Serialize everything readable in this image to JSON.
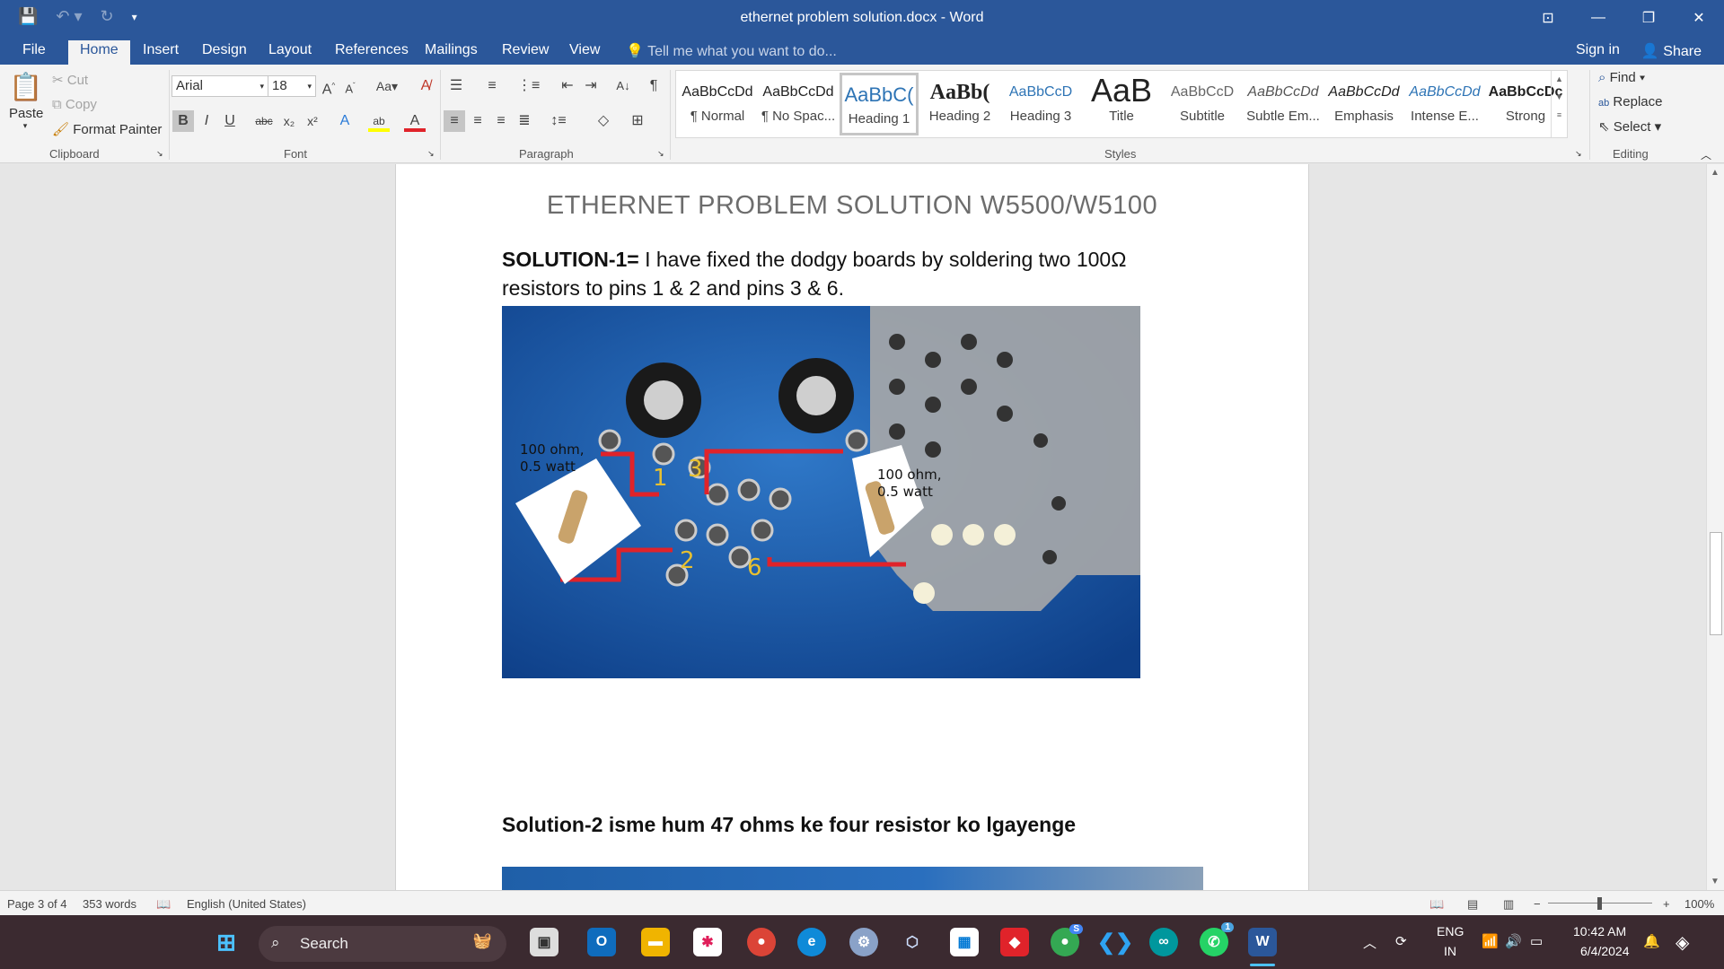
{
  "window": {
    "title": "ethernet problem solution.docx - Word",
    "controls": [
      "ribbon-display",
      "minimize",
      "restore",
      "close"
    ]
  },
  "tabs": {
    "items": [
      "File",
      "Home",
      "Insert",
      "Design",
      "Layout",
      "References",
      "Mailings",
      "Review",
      "View"
    ],
    "active": "Home",
    "tell_me": "Tell me what you want to do...",
    "sign_in": "Sign in",
    "share": "Share"
  },
  "ribbon": {
    "clipboard": {
      "paste": "Paste",
      "cut": "Cut",
      "copy": "Copy",
      "format_painter": "Format Painter",
      "label": "Clipboard"
    },
    "font": {
      "family": "Arial",
      "size": "18",
      "label": "Font"
    },
    "paragraph": {
      "label": "Paragraph"
    },
    "styles": {
      "label": "Styles",
      "items": [
        {
          "preview": "AaBbCcDd",
          "name": "¶ Normal"
        },
        {
          "preview": "AaBbCcDd",
          "name": "¶ No Spac..."
        },
        {
          "preview": "AaBbC(",
          "name": "Heading 1"
        },
        {
          "preview": "AaBb(",
          "name": "Heading 2"
        },
        {
          "preview": "AaBbCcD",
          "name": "Heading 3"
        },
        {
          "preview": "AaB",
          "name": "Title"
        },
        {
          "preview": "AaBbCcD",
          "name": "Subtitle"
        },
        {
          "preview": "AaBbCcDd",
          "name": "Subtle Em..."
        },
        {
          "preview": "AaBbCcDd",
          "name": "Emphasis"
        },
        {
          "preview": "AaBbCcDd",
          "name": "Intense E..."
        },
        {
          "preview": "AaBbCcDc",
          "name": "Strong"
        }
      ],
      "active": "Heading 1"
    },
    "editing": {
      "find": "Find",
      "replace": "Replace",
      "select": "Select",
      "label": "Editing"
    }
  },
  "document": {
    "title": "ETHERNET PROBLEM SOLUTION W5500/W5100",
    "para1_bold": "SOLUTION-1=",
    "para1_text": " I have fixed the dodgy boards by soldering two 100Ω resistors to pins 1 & 2 and pins 3 & 6.",
    "photo_labels": {
      "left_resistor": "100 ohm,\n0.5 watt",
      "right_resistor": "100 ohm,\n0.5 watt",
      "pin1": "1",
      "pin2": "2",
      "pin3": "3",
      "pin6": "6"
    },
    "para2": "Solution-2  isme hum 47 ohms ke four resistor ko lgayenge"
  },
  "statusbar": {
    "page": "Page 3 of 4",
    "words": "353 words",
    "language": "English (United States)",
    "zoom": "100%"
  },
  "taskbar": {
    "search": "Search",
    "lang": "ENG",
    "region": "IN",
    "time": "10:42 AM",
    "date": "6/4/2024",
    "whatsapp_badge": "1",
    "chrome_badge": "S"
  },
  "colors": {
    "word_blue": "#2b579a",
    "heading_gray": "#6d6d6d",
    "red_wire": "#e0232a",
    "pin_yellow": "#e8c030"
  }
}
